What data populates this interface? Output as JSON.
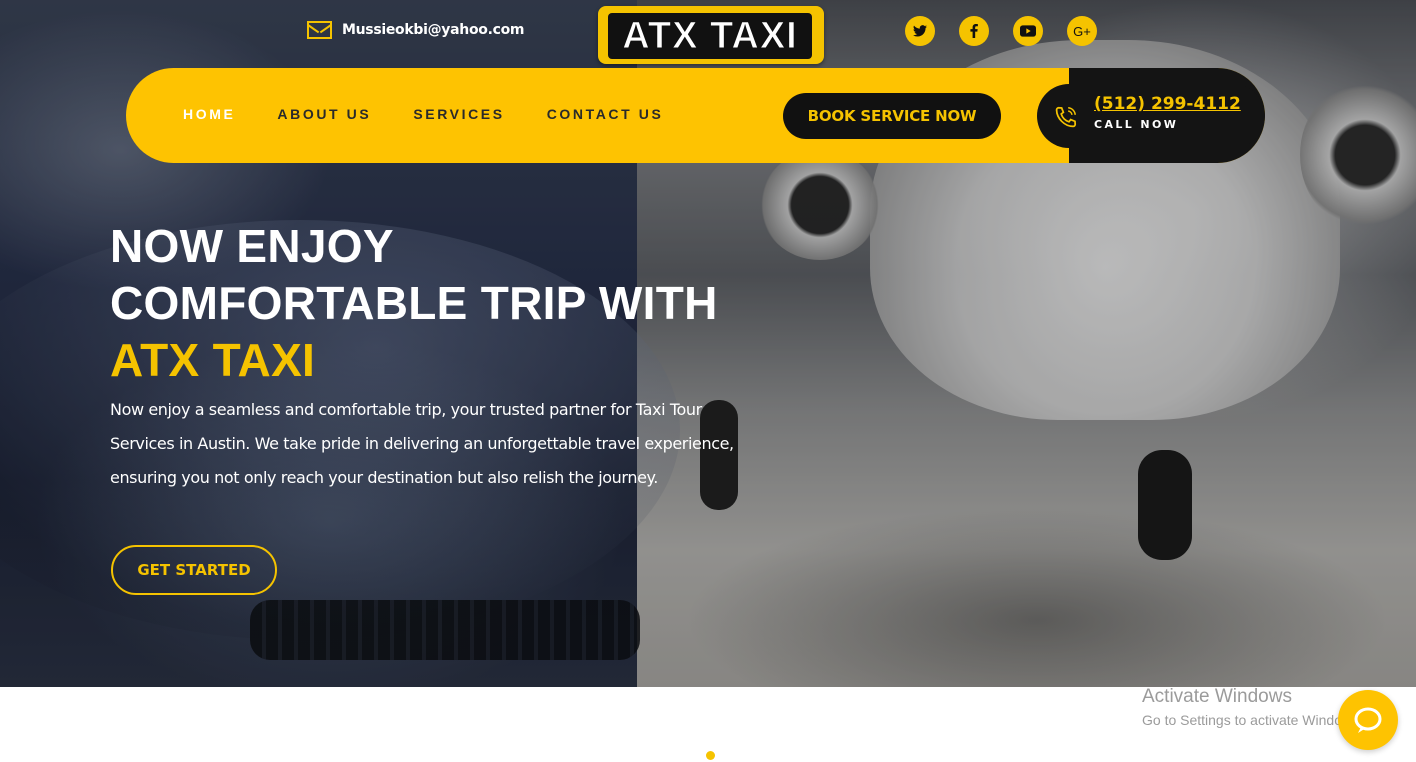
{
  "topbar": {
    "email": "Mussieokbi@yahoo.com",
    "logo_text": "ATX TAXI",
    "socials": [
      {
        "icon": "twitter-icon",
        "glyph": "t"
      },
      {
        "icon": "facebook-icon",
        "glyph": "f"
      },
      {
        "icon": "youtube-icon",
        "glyph": "▶"
      },
      {
        "icon": "google-plus-icon",
        "glyph": "G+"
      }
    ]
  },
  "nav": {
    "items": [
      "HOME",
      "ABOUT US",
      "SERVICES",
      "CONTACT US"
    ],
    "active": "HOME",
    "book_label": "BOOK SERVICE NOW",
    "phone": "(512) 299-4112",
    "call_label": "CALL NOW"
  },
  "hero": {
    "line1": "NOW ENJOY",
    "line2": "COMFORTABLE TRIP WITH",
    "brand": "ATX TAXI",
    "lead": "Now enjoy a seamless and comfortable trip, your trusted partner for Taxi Tour Services in Austin. We take pride in delivering an unforgettable travel experience, ensuring you not only reach your destination but also relish the journey.",
    "cta": "GET STARTED"
  },
  "overlay": {
    "activate_title": "Activate Windows",
    "activate_sub": "Go to Settings to activate Windows."
  },
  "colors": {
    "accent": "#fec301",
    "dark": "#141414",
    "text": "#ffffff"
  }
}
